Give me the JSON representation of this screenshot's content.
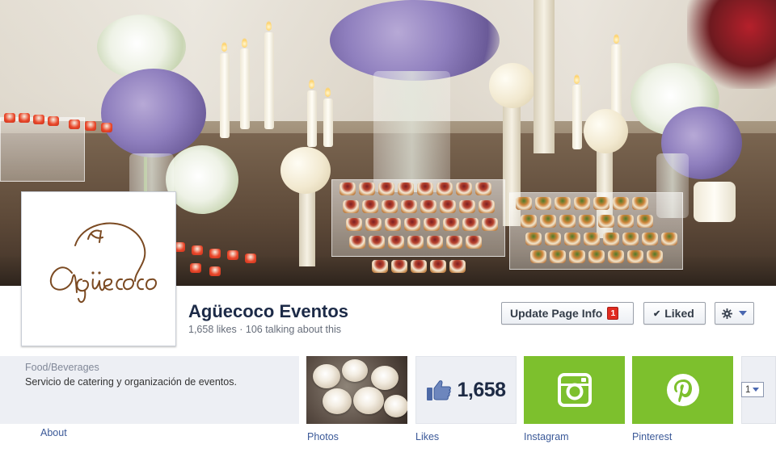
{
  "page": {
    "name": "Agüecoco Eventos",
    "stats": "1,658 likes · 106 talking about this",
    "logo_text": "Agüecoco"
  },
  "actions": {
    "update_info_label": "Update Page Info",
    "update_info_badge": "1",
    "liked_label": "Liked",
    "gear_icon": "gear-icon"
  },
  "about": {
    "category": "Food/Beverages",
    "description": "Servicio de catering y organización de eventos.",
    "link_label": "About"
  },
  "apps": [
    {
      "label": "Photos"
    },
    {
      "label": "Likes",
      "count": "1,658"
    },
    {
      "label": "Instagram"
    },
    {
      "label": "Pinterest"
    }
  ],
  "more_apps": {
    "count": "1"
  },
  "colors": {
    "brand_blue": "#3b5998",
    "app_green": "#7dc02d",
    "badge_red": "#e02b20"
  }
}
